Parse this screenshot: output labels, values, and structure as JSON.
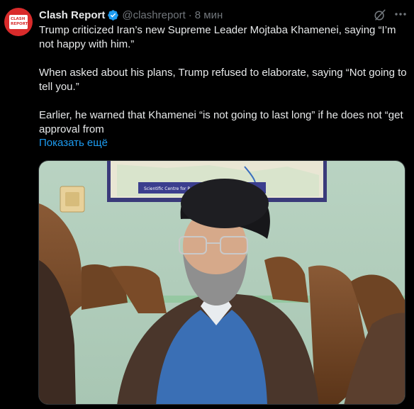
{
  "author": {
    "name": "Clash Report",
    "handle": "@clashreport",
    "separator": "·",
    "time": "8 мин",
    "avatar_logo_line1": "CLASH",
    "avatar_logo_line2": "REPORT"
  },
  "tweet": {
    "paragraphs": [
      "Trump criticized Iran’s new Supreme Leader Mojtaba Khamenei, saying “I’m not happy with him.”",
      "When asked about his plans, Trump refused to elaborate, saying “Not going to tell you.”",
      "Earlier, he warned that Khamenei “is not going to last long” if he does not “get approval from"
    ],
    "show_more": "Показать ещё"
  },
  "icons": {
    "verified": "verified-badge-icon",
    "grok": "grok-icon",
    "more": "more-icon"
  },
  "colors": {
    "background": "#000000",
    "text": "#e7e9ea",
    "muted": "#71767b",
    "link": "#1d9bf0",
    "avatar_red": "#d92b2b"
  },
  "media": {
    "map_caption": "Scientific Centre for Research & Studies"
  }
}
